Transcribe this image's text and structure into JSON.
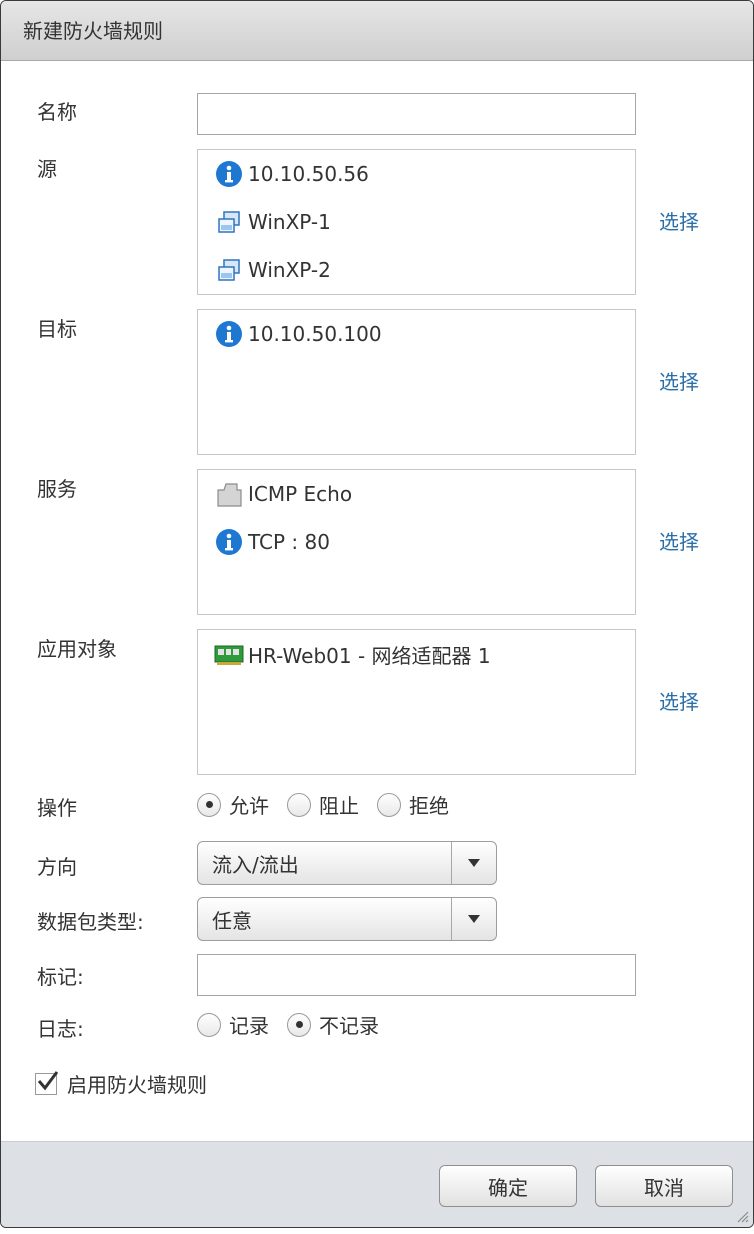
{
  "title": "新建防火墙规则",
  "fields": {
    "name_label": "名称",
    "source_label": "源",
    "target_label": "目标",
    "service_label": "服务",
    "applied_to_label": "应用对象",
    "action_label": "操作",
    "direction_label": "方向",
    "packet_type_label": "数据包类型:",
    "tag_label": "标记:",
    "log_label": "日志:"
  },
  "name_value": "",
  "tag_value": "",
  "select_link": "选择",
  "source_items": [
    {
      "icon": "info-icon",
      "text": "10.10.50.56"
    },
    {
      "icon": "vm-icon",
      "text": "WinXP-1"
    },
    {
      "icon": "vm-icon",
      "text": "WinXP-2"
    }
  ],
  "target_items": [
    {
      "icon": "info-icon",
      "text": "10.10.50.100"
    }
  ],
  "service_items": [
    {
      "icon": "service-icon",
      "text": "ICMP Echo"
    },
    {
      "icon": "info-icon",
      "text": "TCP : 80"
    }
  ],
  "applied_items": [
    {
      "icon": "network-adapter-icon",
      "text": "HR-Web01 - 网络适配器 1"
    }
  ],
  "action": {
    "options": [
      "允许",
      "阻止",
      "拒绝"
    ],
    "selected": "允许"
  },
  "direction": {
    "selected": "流入/流出"
  },
  "packet_type": {
    "selected": "任意"
  },
  "log": {
    "options": [
      "记录",
      "不记录"
    ],
    "selected": "不记录"
  },
  "enable_rule": {
    "label": "启用防火墙规则",
    "checked": true
  },
  "buttons": {
    "ok": "确定",
    "cancel": "取消"
  },
  "colors": {
    "link": "#2a6ea8",
    "info_icon": "#1e78d2",
    "footer": "#dde1e5"
  }
}
